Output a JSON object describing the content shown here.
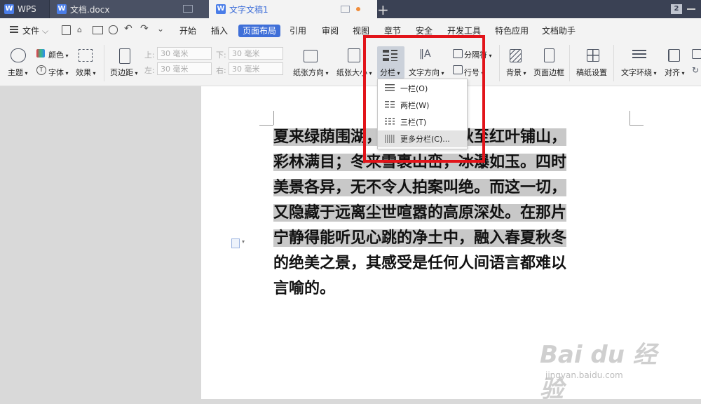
{
  "tabs": {
    "wps": "WPS",
    "doc1": "文档.docx",
    "doc2": "文字文稿1",
    "add": "+",
    "badge": "2"
  },
  "menu": {
    "file": "文件",
    "items": [
      "开始",
      "插入",
      "页面布局",
      "引用",
      "审阅",
      "视图",
      "章节",
      "安全",
      "开发工具",
      "特色应用",
      "文档助手"
    ]
  },
  "ribbon": {
    "theme": "主题",
    "color": "颜色",
    "font": "字体",
    "effect": "效果",
    "margin": "页边距",
    "top_label": "上:",
    "bottom_label": "下:",
    "left_label": "左:",
    "right_label": "右:",
    "margin_value": "30 毫米",
    "orientation": "纸张方向",
    "size": "纸张大小",
    "columns": "分栏",
    "text_direction": "文字方向",
    "separator": "分隔符",
    "line_number": "行号",
    "background": "背景",
    "page_border": "页面边框",
    "grid_setup": "稿纸设置",
    "text_wrap": "文字环绕",
    "align": "对齐"
  },
  "dropdown": {
    "items": [
      "一栏(O)",
      "两栏(W)",
      "三栏(T)",
      "更多分栏(C)..."
    ]
  },
  "document": {
    "lines": [
      "夏来绿荫围湖，莺飞燕舞；秋至红叶铺山，",
      "彩林满目；冬来雪裹山峦，冰瀑如玉。四时",
      "美景各异，无不令人拍案叫绝。而这一切，",
      "又隐藏于远离尘世喧嚣的高原深处。在那片",
      "宁静得能听见心跳的净土中，融入春夏秋冬",
      "的绝美之景，其感受是任何人间语言都难以",
      "言喻的。"
    ]
  },
  "watermark": {
    "main": "Bai du 经验",
    "sub": "jingyan.baidu.com"
  }
}
